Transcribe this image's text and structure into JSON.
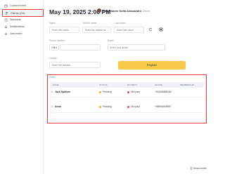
{
  "sidebar": {
    "items": [
      {
        "label": "Current event",
        "icon": "calendar-icon"
      },
      {
        "label": "Clients (2/6)",
        "icon": "people-icon",
        "active": true
      },
      {
        "label": "Schedule",
        "icon": "clock-icon"
      },
      {
        "label": "Notifications",
        "icon": "bell-icon"
      },
      {
        "label": "Join event",
        "icon": "plus-icon"
      }
    ]
  },
  "header": {
    "date_time": "May 19, 2025 2:00 PM",
    "trainer_name": "Yoga trainer Sofia Alessandro",
    "trainer_suffix": "Owner"
  },
  "form": {
    "name_label": "Name",
    "name_placeholder": "Enter first name",
    "middle_label": "Middle name",
    "middle_placeholder": "Enter the middle na",
    "last_label": "Last name",
    "last_placeholder": "Enter last name",
    "phone_label": "Phone number",
    "phone_prefix": "+38",
    "email_label": "Email",
    "email_placeholder": "Enter your email",
    "loyalty_label": "Loyalty",
    "loyalty_placeholder": "Enter the number",
    "register_label": "Register"
  },
  "clients": {
    "title": "Clients",
    "columns": [
      "NAME",
      "STATUS",
      "PAYMENT",
      "PHONE",
      "MEMBERSHIP"
    ],
    "rows": [
      {
        "name": "Jack Spillson",
        "status": "Pending",
        "payment": "Not paid",
        "phone": "+31934484418",
        "membership": ""
      },
      {
        "name": "Anna",
        "status": "Pending",
        "payment": "Not paid",
        "phone": "+38934415597",
        "membership": ""
      }
    ]
  },
  "footer": {
    "device_mode": "Device mode"
  },
  "colors": {
    "accent": "#f7c948",
    "highlight_border": "#e53935",
    "pending": "#f2b134",
    "not_paid": "#e24b4b"
  }
}
